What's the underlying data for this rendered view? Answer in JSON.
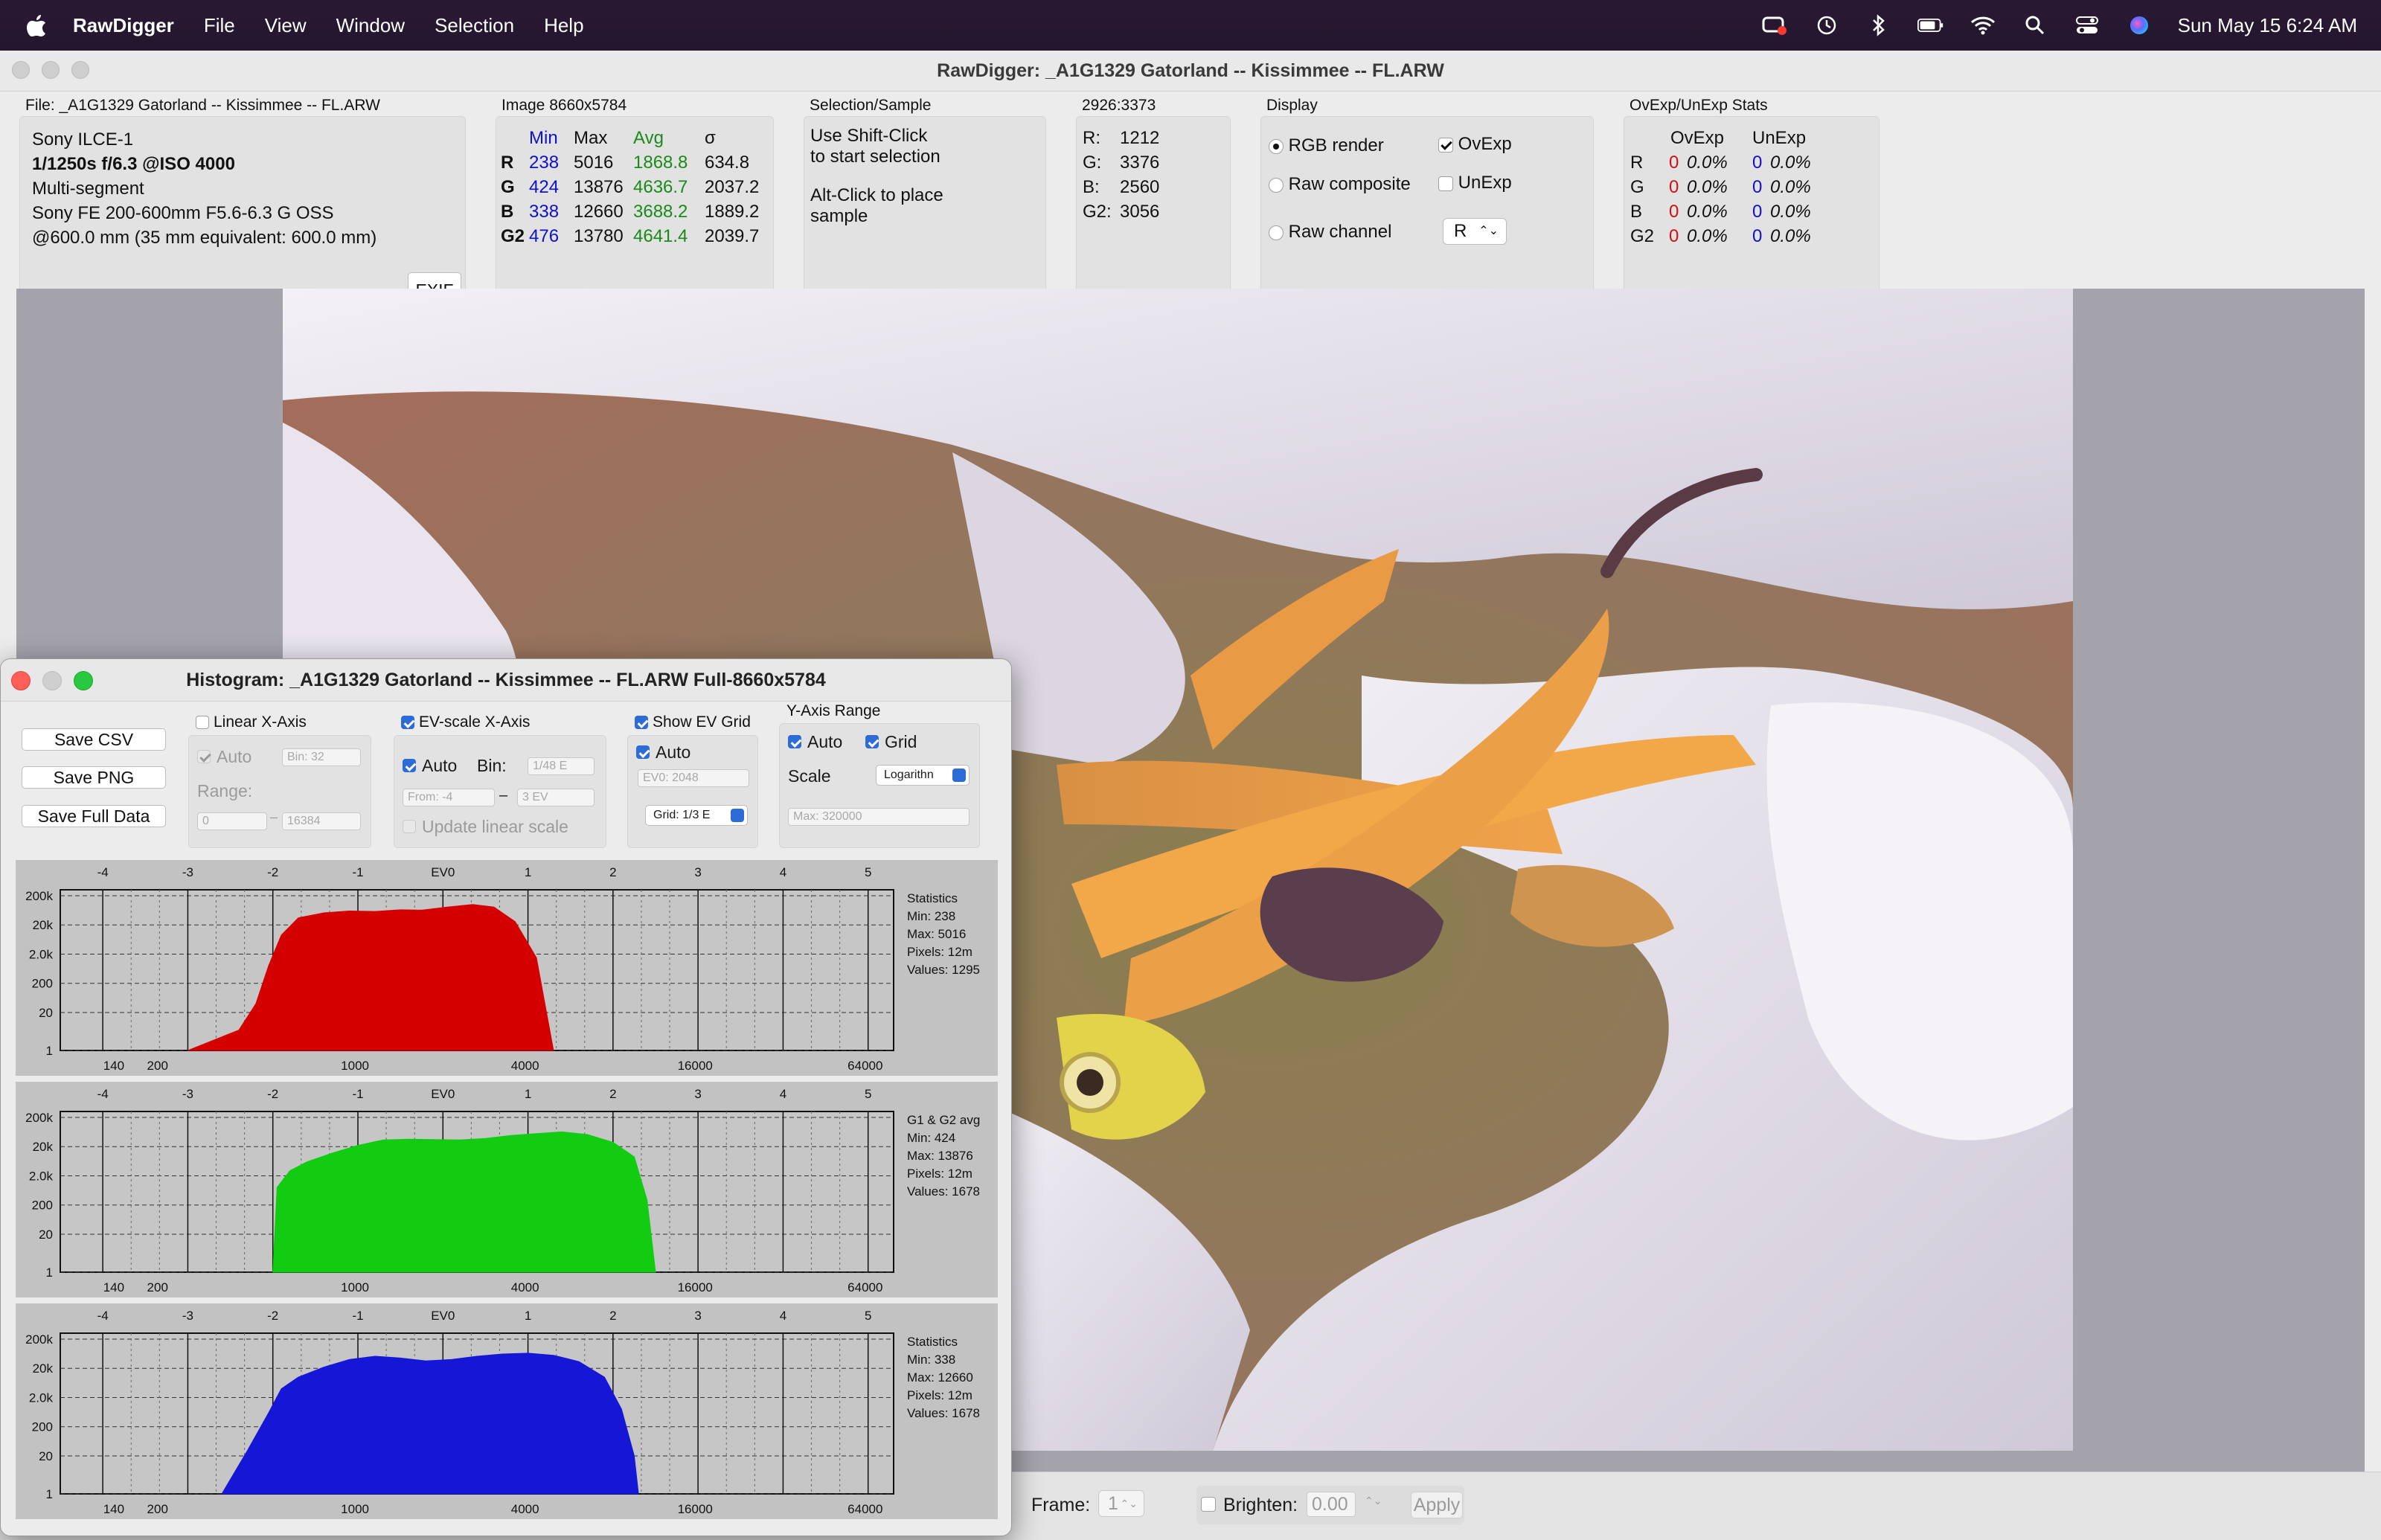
{
  "menubar": {
    "app": "RawDigger",
    "menus": [
      "File",
      "View",
      "Window",
      "Selection",
      "Help"
    ],
    "clock": "Sun May 15  6:24 AM"
  },
  "main": {
    "title": "RawDigger: _A1G1329 Gatorland -- Kissimmee --  FL.ARW",
    "file_label": "File: _A1G1329 Gatorland -- Kissimmee --  FL.ARW",
    "camera": "Sony ILCE-1",
    "exposure": "1/1250s f/6.3 @ISO 4000",
    "mode": "Multi-segment",
    "lens": "Sony FE 200-600mm F5.6-6.3 G OSS",
    "focal": "@600.0 mm (35 mm equivalent: 600.0 mm)",
    "exif_button": "EXIF",
    "image_label": "Image 8660x5784",
    "stats_headers": [
      "Min",
      "Max",
      "Avg",
      "σ"
    ],
    "stats_rows": [
      {
        "ch": "R",
        "min": "238",
        "max": "5016",
        "avg": "1868.8",
        "sd": "634.8"
      },
      {
        "ch": "G",
        "min": "424",
        "max": "13876",
        "avg": "4636.7",
        "sd": "2037.2"
      },
      {
        "ch": "B",
        "min": "338",
        "max": "12660",
        "avg": "3688.2",
        "sd": "1889.2"
      },
      {
        "ch": "G2",
        "min": "476",
        "max": "13780",
        "avg": "4641.4",
        "sd": "2039.7"
      }
    ],
    "selection_label": "Selection/Sample",
    "selection_lines": [
      "Use Shift-Click",
      "to start selection",
      "Alt-Click to place",
      "sample"
    ],
    "coord_label": "2926:3373",
    "sample_rows": [
      {
        "ch": "R:",
        "v": "1212"
      },
      {
        "ch": "G:",
        "v": "3376"
      },
      {
        "ch": "B:",
        "v": "2560"
      },
      {
        "ch": "G2:",
        "v": "3056"
      }
    ],
    "display_label": "Display",
    "display_options": [
      "RGB render",
      "Raw composite",
      "Raw channel"
    ],
    "ovexp_label": "OvExp",
    "unexp_label": "UnExp",
    "raw_channel_value": "R",
    "ovstats_label": "OvExp/UnExp Stats",
    "ovstats_headers": [
      "OvExp",
      "UnExp"
    ],
    "ovstats_rows": [
      {
        "ch": "R",
        "ov": "0",
        "ovp": "0.0%",
        "un": "0",
        "unp": "0.0%"
      },
      {
        "ch": "G",
        "ov": "0",
        "ovp": "0.0%",
        "un": "0",
        "unp": "0.0%"
      },
      {
        "ch": "B",
        "ov": "0",
        "ovp": "0.0%",
        "un": "0",
        "unp": "0.0%"
      },
      {
        "ch": "G2",
        "ov": "0",
        "ovp": "0.0%",
        "un": "0",
        "unp": "0.0%"
      }
    ]
  },
  "bottom": {
    "frame_label": "Frame:",
    "frame_value": "1",
    "brighten_label": "Brighten:",
    "brighten_value": "0.00",
    "apply_label": "Apply"
  },
  "histogram": {
    "title": "Histogram: _A1G1329 Gatorland -- Kissimmee --  FL.ARW Full-8660x5784",
    "buttons": [
      "Save CSV",
      "Save PNG",
      "Save Full Data"
    ],
    "linear_x_label": "Linear X-Axis",
    "auto_label": "Auto",
    "bin_placeholder": "Bin: 32",
    "range_label": "Range:",
    "range_from": "0",
    "range_to": "16384",
    "range_sep": "–",
    "ev_scale_label": "EV-scale X-Axis",
    "bin_label": "Bin:",
    "ev_bin_value": "1/48 E",
    "from_value": "From: -4",
    "to_value": "3 EV",
    "dash": "–",
    "update_linear_label": "Update linear scale",
    "show_ev_grid_label": "Show EV Grid",
    "ev0_value": "EV0: 2048",
    "grid_value": "Grid: 1/3 E",
    "y_axis_label": "Y-Axis Range",
    "grid_label": "Grid",
    "scale_label": "Scale",
    "scale_value": "Logarithn",
    "max_value": "Max: 320000",
    "ev_ticks": [
      "-4",
      "-3",
      "-2",
      "-1",
      "EV0",
      "1",
      "2",
      "3",
      "4",
      "5"
    ],
    "y_ticks": [
      "200k",
      "20k",
      "2.0k",
      "200",
      "20",
      "1"
    ],
    "x_ticks": [
      "140",
      "200",
      "1000",
      "4000",
      "16000",
      "64000"
    ]
  },
  "chart_data": [
    {
      "type": "area",
      "name": "R",
      "color": "#d40000",
      "scale": "log-log",
      "x_axis_ev": [
        -4,
        5
      ],
      "x_ticks_values": [
        140,
        200,
        1000,
        4000,
        16000,
        64000
      ],
      "y_ticks_values": [
        "200k",
        "20k",
        "2.0k",
        "200",
        "20",
        "1"
      ],
      "ev": [
        -3.0,
        -2.4,
        -2.2,
        -2.05,
        -1.9,
        -1.7,
        -1.4,
        -1.1,
        -0.8,
        -0.5,
        -0.25,
        0.05,
        0.35,
        0.6,
        0.85,
        1.1,
        1.3
      ],
      "counts": [
        1,
        5,
        40,
        800,
        9000,
        35000,
        52000,
        60000,
        58000,
        66000,
        64000,
        82000,
        100000,
        82000,
        26000,
        1500,
        1
      ],
      "stats": {
        "title": "Statistics",
        "min": "Min: 238",
        "max": "Max: 5016",
        "pixels": "Pixels: 12m",
        "values": "Values: 1295"
      }
    },
    {
      "type": "area",
      "name": "G1 & G2 avg",
      "color": "#11cc11",
      "scale": "log-log",
      "x_axis_ev": [
        -4,
        5
      ],
      "x_ticks_values": [
        140,
        200,
        1000,
        4000,
        16000,
        64000
      ],
      "y_ticks_values": [
        "200k",
        "20k",
        "2.0k",
        "200",
        "20",
        "1"
      ],
      "ev": [
        -2.0,
        -1.95,
        -1.8,
        -1.6,
        -1.3,
        -1.0,
        -0.7,
        -0.4,
        -0.1,
        0.2,
        0.5,
        0.8,
        1.1,
        1.4,
        1.7,
        2.0,
        2.25,
        2.4,
        2.5
      ],
      "counts": [
        1,
        800,
        3000,
        6000,
        12000,
        22000,
        34000,
        36000,
        35000,
        34000,
        38000,
        48000,
        56000,
        64000,
        52000,
        28000,
        9000,
        300,
        1
      ],
      "stats": {
        "title": "G1 & G2 avg",
        "min": "Min: 424",
        "max": "Max: 13876",
        "pixels": "Pixels: 12m",
        "values": "Values: 1678"
      }
    },
    {
      "type": "area",
      "name": "B",
      "color": "#1616d6",
      "scale": "log-log",
      "x_axis_ev": [
        -4,
        5
      ],
      "x_ticks_values": [
        140,
        200,
        1000,
        4000,
        16000,
        64000
      ],
      "y_ticks_values": [
        "200k",
        "20k",
        "2.0k",
        "200",
        "20",
        "1"
      ],
      "ev": [
        -2.6,
        -2.3,
        -2.05,
        -1.9,
        -1.7,
        -1.4,
        -1.1,
        -0.8,
        -0.5,
        -0.2,
        0.1,
        0.4,
        0.7,
        1.0,
        1.3,
        1.6,
        1.9,
        2.1,
        2.25,
        2.3
      ],
      "counts": [
        1,
        30,
        600,
        4000,
        10000,
        22000,
        40000,
        52000,
        45000,
        36000,
        40000,
        52000,
        62000,
        66000,
        56000,
        34000,
        10000,
        800,
        20,
        1
      ],
      "stats": {
        "title": "Statistics",
        "min": "Min: 338",
        "max": "Max: 12660",
        "pixels": "Pixels: 12m",
        "values": "Values: 1678"
      }
    }
  ]
}
